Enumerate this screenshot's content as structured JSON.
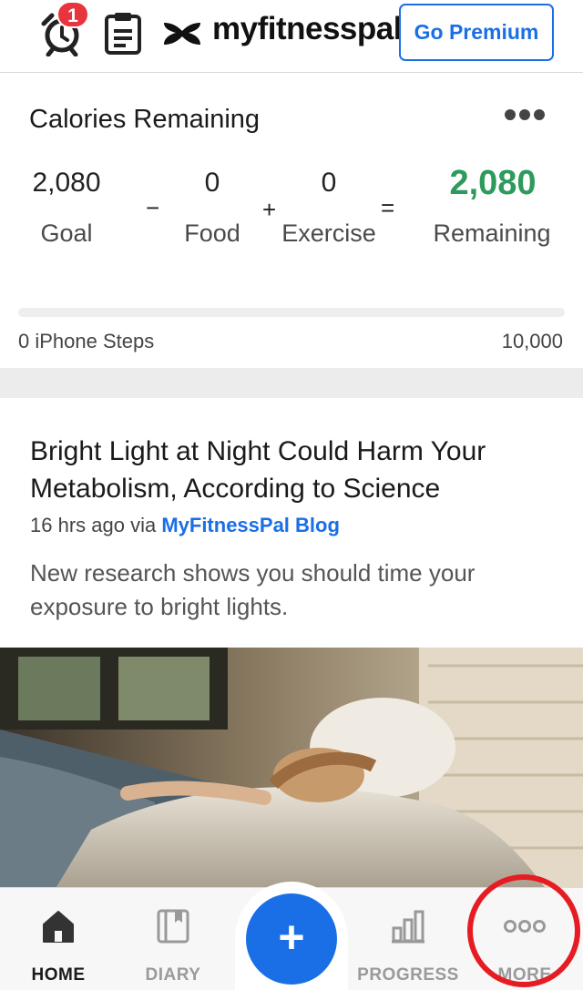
{
  "header": {
    "notification_count": "1",
    "brand": "myfitnesspal",
    "premium_label": "Go Premium",
    "icons": [
      "alarm-clock-icon",
      "clipboard-icon",
      "under-armour-logo"
    ]
  },
  "calories": {
    "title": "Calories Remaining",
    "goal_value": "2,080",
    "goal_label": "Goal",
    "minus": "−",
    "food_value": "0",
    "food_label": "Food",
    "plus": "+",
    "exercise_value": "0",
    "exercise_label": "Exercise",
    "equals": "=",
    "remaining_value": "2,080",
    "remaining_label": "Remaining",
    "steps_label": "0 iPhone Steps",
    "steps_goal": "10,000",
    "steps_progress": 0
  },
  "article": {
    "title": "Bright Light at Night Could Harm Your Metabolism, According to Science",
    "time": "16 hrs ago via ",
    "source": "MyFitnessPal Blog",
    "description": "New research shows you should time your exposure to bright lights."
  },
  "nav": {
    "home": "HOME",
    "diary": "DIARY",
    "add": "+",
    "progress": "PROGRESS",
    "more": "MORE",
    "active": "home"
  },
  "colors": {
    "accent": "#1a6fe6",
    "remaining": "#2e9a5c",
    "badge": "#e8343c",
    "highlight_circle": "#e51c23"
  }
}
